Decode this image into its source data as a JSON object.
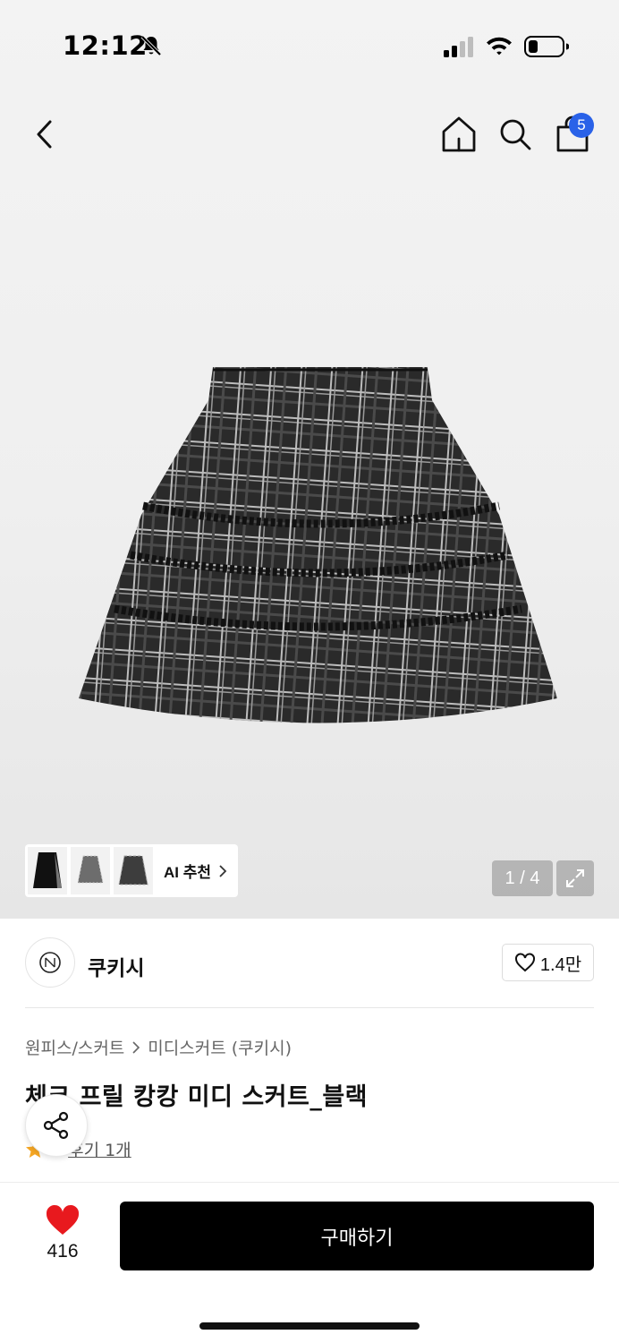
{
  "status_bar": {
    "time": "12:12"
  },
  "nav": {
    "cart_badge": "5"
  },
  "gallery": {
    "counter": "1 / 4",
    "ai_label": "AI 추천"
  },
  "brand": {
    "name": "쿠키시",
    "like_count": "1.4만"
  },
  "product": {
    "breadcrumb": [
      "원피스/스커트",
      "미디스커트 (쿠키시)"
    ],
    "title": "체크 프릴 캉캉 미디 스커트_블랙",
    "rating": "5",
    "review_link": "후기 1개"
  },
  "bottom_bar": {
    "wish_count": "416",
    "buy_label": "구매하기"
  },
  "colors": {
    "accent_badge": "#2a62e8",
    "heart": "#e8191e",
    "star": "#f5a623",
    "buy_button": "#000000"
  }
}
